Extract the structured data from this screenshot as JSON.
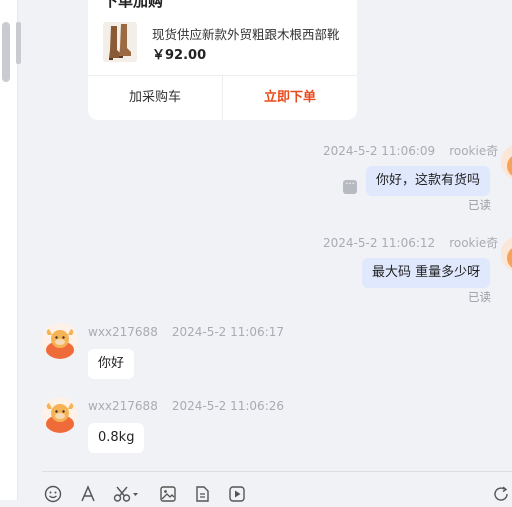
{
  "card": {
    "title": "下单加购",
    "product_name": "现货供应新款外贸粗跟木根西部靴",
    "price": "￥92.00",
    "add_cart_label": "加采购车",
    "buy_now_label": "立即下单",
    "buy_color": "#e94b1c"
  },
  "messages": [
    {
      "direction": "out",
      "time": "2024-5-2 11:06:09",
      "sender": "rookie奇",
      "text": "你好，这款有货吗",
      "status": "已读"
    },
    {
      "direction": "out",
      "time": "2024-5-2 11:06:12",
      "sender": "rookie奇",
      "text": "最大码 重量多少呀",
      "status": "已读"
    },
    {
      "direction": "in",
      "time": "2024-5-2 11:06:17",
      "sender": "wxx217688",
      "text": "你好"
    },
    {
      "direction": "in",
      "time": "2024-5-2 11:06:26",
      "sender": "wxx217688",
      "text": "0.8kg"
    }
  ],
  "toolbar": {
    "icons": [
      "emoji-icon",
      "font-icon",
      "scissors-icon",
      "image-icon",
      "file-icon",
      "video-icon",
      "history-icon"
    ]
  },
  "colors": {
    "outgoing_bubble": "#dfe8fc",
    "incoming_bubble": "#ffffff",
    "background": "#f1f2f6"
  }
}
